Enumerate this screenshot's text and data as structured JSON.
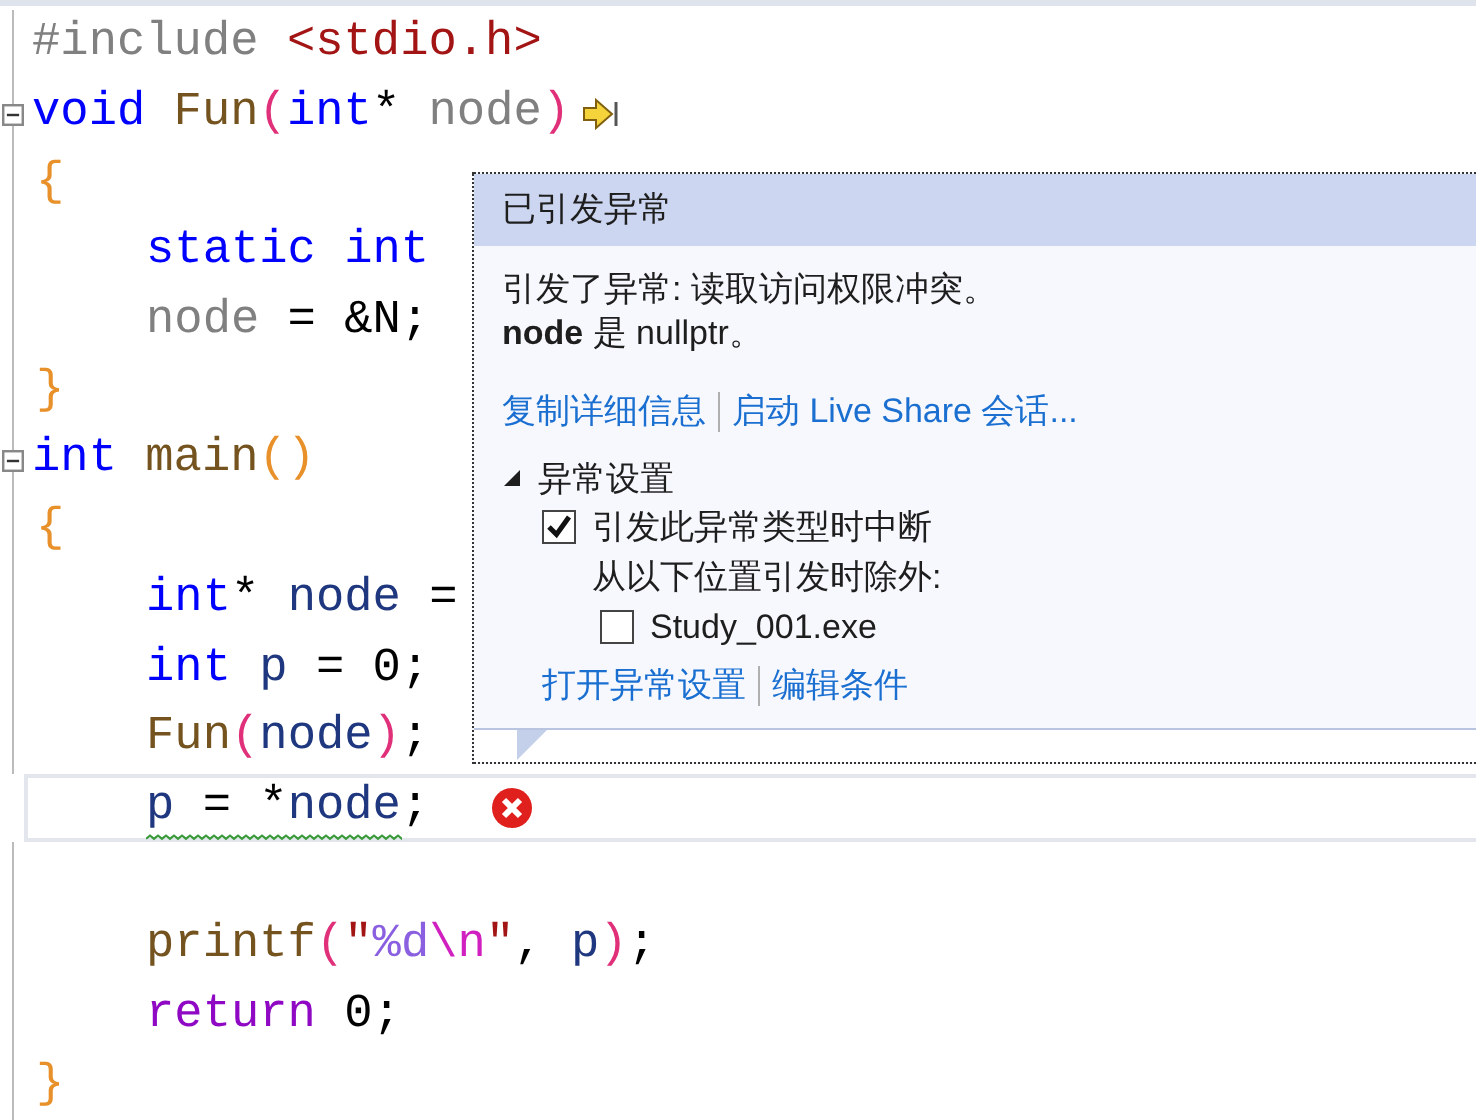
{
  "editor": {
    "lines": [
      {
        "kind": "top",
        "fold": false,
        "step": false,
        "error": false,
        "tokens": [
          {
            "text": "#include ",
            "kind": "directive"
          },
          {
            "text": "<stdio.h>",
            "kind": "string"
          }
        ]
      },
      {
        "kind": "top",
        "fold": true,
        "step": true,
        "error": false,
        "tokens": [
          {
            "text": "void ",
            "kind": "keyword"
          },
          {
            "text": "Fun",
            "kind": "function"
          },
          {
            "text": "(",
            "kind": "paren"
          },
          {
            "text": "int",
            "kind": "keyword"
          },
          {
            "text": "* ",
            "kind": "plain"
          },
          {
            "text": "node",
            "kind": "param"
          },
          {
            "text": ")",
            "kind": "paren"
          }
        ]
      },
      {
        "kind": "brace",
        "fold": false,
        "step": false,
        "error": false,
        "tokens": [
          {
            "text": "{",
            "kind": "brace"
          }
        ]
      },
      {
        "kind": "body",
        "fold": false,
        "step": false,
        "error": false,
        "tokens": [
          {
            "text": "static int",
            "kind": "keyword"
          }
        ]
      },
      {
        "kind": "body",
        "fold": false,
        "step": false,
        "error": false,
        "tokens": [
          {
            "text": "node",
            "kind": "param"
          },
          {
            "text": " = &N;",
            "kind": "plain"
          }
        ]
      },
      {
        "kind": "brace",
        "fold": false,
        "step": false,
        "error": false,
        "tokens": [
          {
            "text": "}",
            "kind": "brace"
          }
        ]
      },
      {
        "kind": "top",
        "fold": true,
        "step": false,
        "error": false,
        "tokens": [
          {
            "text": "int ",
            "kind": "keyword"
          },
          {
            "text": "main",
            "kind": "function"
          },
          {
            "text": "()",
            "kind": "brace"
          }
        ]
      },
      {
        "kind": "brace",
        "fold": false,
        "step": false,
        "error": false,
        "tokens": [
          {
            "text": "{",
            "kind": "brace"
          }
        ]
      },
      {
        "kind": "body",
        "fold": false,
        "step": false,
        "error": false,
        "tokens": [
          {
            "text": "int",
            "kind": "keyword"
          },
          {
            "text": "* ",
            "kind": "plain"
          },
          {
            "text": "node",
            "kind": "local"
          },
          {
            "text": " =",
            "kind": "plain"
          }
        ]
      },
      {
        "kind": "body",
        "fold": false,
        "step": false,
        "error": false,
        "tokens": [
          {
            "text": "int ",
            "kind": "keyword"
          },
          {
            "text": "p",
            "kind": "local"
          },
          {
            "text": " = 0;",
            "kind": "plain"
          }
        ]
      },
      {
        "kind": "body",
        "fold": false,
        "step": false,
        "error": false,
        "tokens": [
          {
            "text": "Fun",
            "kind": "function"
          },
          {
            "text": "(",
            "kind": "paren"
          },
          {
            "text": "node",
            "kind": "local"
          },
          {
            "text": ")",
            "kind": "paren"
          },
          {
            "text": ";",
            "kind": "plain"
          }
        ]
      },
      {
        "kind": "body",
        "fold": false,
        "step": false,
        "error": true,
        "tokens": [
          {
            "text": "p",
            "kind": "local"
          },
          {
            "text": " = *",
            "kind": "plain"
          },
          {
            "text": "node",
            "kind": "local"
          },
          {
            "text": ";",
            "kind": "plain"
          }
        ]
      },
      {
        "kind": "blank",
        "fold": false,
        "step": false,
        "error": false
      },
      {
        "kind": "body",
        "fold": false,
        "step": false,
        "error": false,
        "tokens": [
          {
            "text": "printf",
            "kind": "function"
          },
          {
            "text": "(",
            "kind": "paren"
          },
          {
            "text": "\"",
            "kind": "string"
          },
          {
            "text": "%d",
            "kind": "format"
          },
          {
            "text": "\\n",
            "kind": "escape"
          },
          {
            "text": "\"",
            "kind": "string"
          },
          {
            "text": ", ",
            "kind": "plain"
          },
          {
            "text": "p",
            "kind": "local"
          },
          {
            "text": ")",
            "kind": "paren"
          },
          {
            "text": ";",
            "kind": "plain"
          }
        ]
      },
      {
        "kind": "body",
        "fold": false,
        "step": false,
        "error": false,
        "tokens": [
          {
            "text": "return ",
            "kind": "control"
          },
          {
            "text": "0;",
            "kind": "plain"
          }
        ]
      },
      {
        "kind": "brace",
        "fold": false,
        "step": false,
        "error": false,
        "tokens": [
          {
            "text": "}",
            "kind": "brace"
          }
        ]
      }
    ]
  },
  "exception_popup": {
    "title": "已引发异常",
    "message": [
      "引发了异常: 读取访问权限冲突。",
      "**node** 是 nullptr。"
    ],
    "links": [
      "复制详细信息",
      "启动 Live Share 会话..."
    ],
    "settings": {
      "title": "异常设置",
      "expanded": true,
      "break_option": {
        "label": "引发此异常类型时中断",
        "checked": true
      },
      "except_label": "从以下位置引发时除外:",
      "modules": [
        {
          "label": "Study_001.exe",
          "checked": false
        }
      ],
      "links": [
        "打开异常设置",
        "编辑条件"
      ]
    }
  }
}
